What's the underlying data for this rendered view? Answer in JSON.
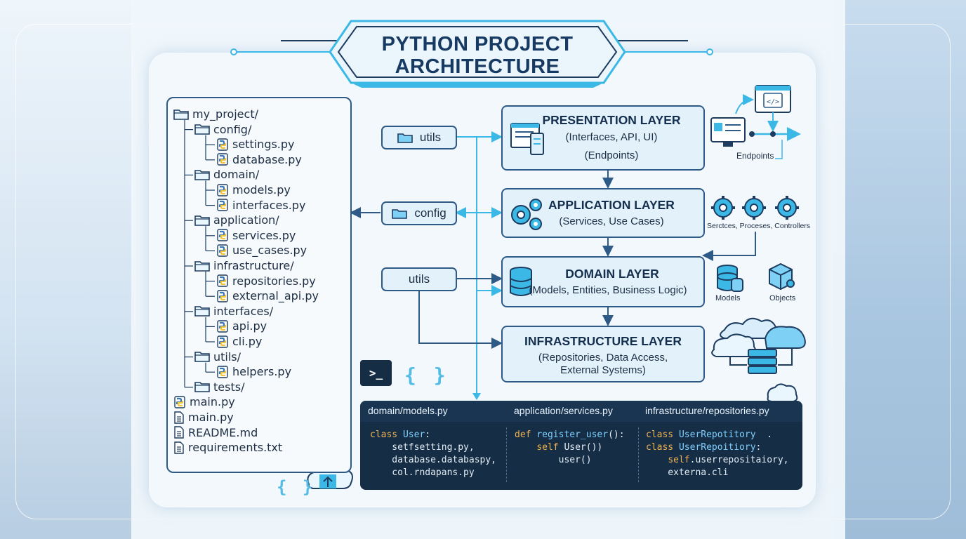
{
  "title": {
    "line1": "PYTHON PROJECT",
    "line2": "ARCHITECTURE"
  },
  "tree": [
    {
      "label": "my_project/",
      "icon": "folder-icon",
      "depth": 0
    },
    {
      "label": "config/",
      "icon": "folder-icon",
      "depth": 1
    },
    {
      "label": "settings.py",
      "icon": "python-file-icon",
      "depth": 2
    },
    {
      "label": "database.py",
      "icon": "python-file-icon",
      "depth": 2
    },
    {
      "label": "domain/",
      "icon": "folder-icon",
      "depth": 1
    },
    {
      "label": "models.py",
      "icon": "python-file-icon",
      "depth": 2
    },
    {
      "label": "interfaces.py",
      "icon": "python-file-icon",
      "depth": 2
    },
    {
      "label": "application/",
      "icon": "folder-icon",
      "depth": 1
    },
    {
      "label": "services.py",
      "icon": "python-file-icon",
      "depth": 2
    },
    {
      "label": "use_cases.py",
      "icon": "python-file-icon",
      "depth": 2
    },
    {
      "label": "infrastructure/",
      "icon": "folder-icon",
      "depth": 1
    },
    {
      "label": "repositories.py",
      "icon": "python-file-icon",
      "depth": 2
    },
    {
      "label": "external_api.py",
      "icon": "python-file-icon",
      "depth": 2
    },
    {
      "label": "interfaces/",
      "icon": "folder-icon",
      "depth": 1
    },
    {
      "label": "api.py",
      "icon": "python-file-icon",
      "depth": 2
    },
    {
      "label": "cli.py",
      "icon": "python-file-icon",
      "depth": 2
    },
    {
      "label": "utils/",
      "icon": "folder-icon",
      "depth": 1
    },
    {
      "label": "helpers.py",
      "icon": "python-file-icon",
      "depth": 2
    },
    {
      "label": "tests/",
      "icon": "folder-icon",
      "depth": 1
    },
    {
      "label": "main.py",
      "icon": "python-file-icon",
      "depth": 0
    },
    {
      "label": "main.py",
      "icon": "document-icon",
      "depth": 0
    },
    {
      "label": "README.md",
      "icon": "document-icon",
      "depth": 0
    },
    {
      "label": "requirements.txt",
      "icon": "document-icon",
      "depth": 0
    }
  ],
  "pills": {
    "utils_top": "utils",
    "config": "config",
    "utils_mid": "utils"
  },
  "layers": {
    "presentation": {
      "title": "PRESENTATION LAYER",
      "sub1": "(Interfaces, API, UI)",
      "sub2": "(Endpoints)"
    },
    "application": {
      "title": "APPLICATION LAYER",
      "sub1": "(Services, Use Cases)"
    },
    "domain": {
      "title": "DOMAIN LAYER",
      "sub1": "(Models, Entities, Business Logic)"
    },
    "infrastructure": {
      "title": "INFRASTRUCTURE LAYER",
      "sub1": "(Repositories, Data Access,",
      "sub2": "External Systems)"
    }
  },
  "side_labels": {
    "endpoints": "Endpoints",
    "services": "Serctces, Proceses, Controllers",
    "models": "Models",
    "objects": "Objects"
  },
  "code": {
    "headers": [
      "domain/models.py",
      "application/services.py",
      "infrastructure/repositories.py"
    ],
    "col1": [
      "class User:",
      "    setfsetting.py,",
      "    database.databaspy,",
      "    col.rndapans.py"
    ],
    "col2": [
      "def register_user():",
      "    self User())",
      "        user()"
    ],
    "col3": [
      "class UserRepotitory  .",
      "class UserRepoitiory:",
      "    self.userrepositaiory,",
      "    externa.cli"
    ]
  },
  "terminal_prompt": ">_",
  "braces": "{ }",
  "colors": {
    "accent": "#3bb8e6",
    "navy": "#2d5a87",
    "code_bg": "#152d45",
    "keyword": "#f2b34f"
  }
}
